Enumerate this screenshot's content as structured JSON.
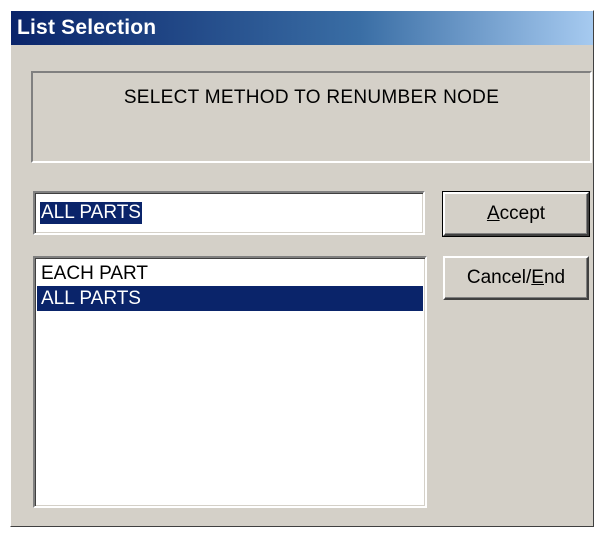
{
  "window": {
    "title": "List Selection"
  },
  "prompt": {
    "text": "SELECT METHOD TO RENUMBER NODE"
  },
  "selection_field": {
    "value": "ALL PARTS"
  },
  "list": {
    "items": [
      {
        "label": "EACH PART",
        "selected": false
      },
      {
        "label": "ALL PARTS",
        "selected": true
      }
    ]
  },
  "buttons": {
    "accept": {
      "mnemonic": "A",
      "rest": "ccept"
    },
    "cancel": {
      "pre": "Cancel/",
      "mnemonic": "E",
      "rest": "nd"
    }
  },
  "colors": {
    "selection": "#0a246a",
    "dialog_bg": "#d4d0c8"
  }
}
